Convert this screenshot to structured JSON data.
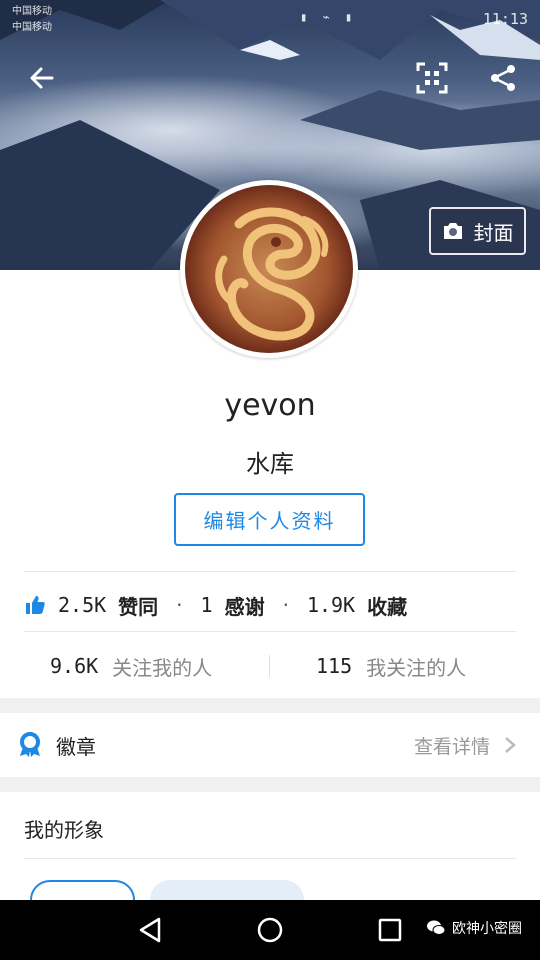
{
  "status_bar": {
    "carrier_1": "中国移动",
    "carrier_2": "中国移动",
    "time": "11:13"
  },
  "header": {
    "back_icon": "arrow-left-icon",
    "qr_icon": "qr-code-scan-icon",
    "share_icon": "share-icon",
    "cover_button_label": "封面"
  },
  "profile": {
    "name": "yevon",
    "bio": "水库",
    "edit_button_label": "编辑个人资料"
  },
  "stats": {
    "likes_count": "2.5K",
    "likes_label": "赞同",
    "thanks_count": "1",
    "thanks_label": "感谢",
    "favorites_count": "1.9K",
    "favorites_label": "收藏",
    "separator": "·"
  },
  "follow": {
    "followers_count": "9.6K",
    "followers_label": "关注我的人",
    "following_count": "115",
    "following_label": "我关注的人"
  },
  "badges": {
    "label": "徽章",
    "detail_label": "查看详情"
  },
  "image_section": {
    "title": "我的形象"
  },
  "watermark": {
    "text": "欧神小密圈"
  },
  "colors": {
    "accent": "#1e88e5",
    "nav_bar": "#000000"
  }
}
